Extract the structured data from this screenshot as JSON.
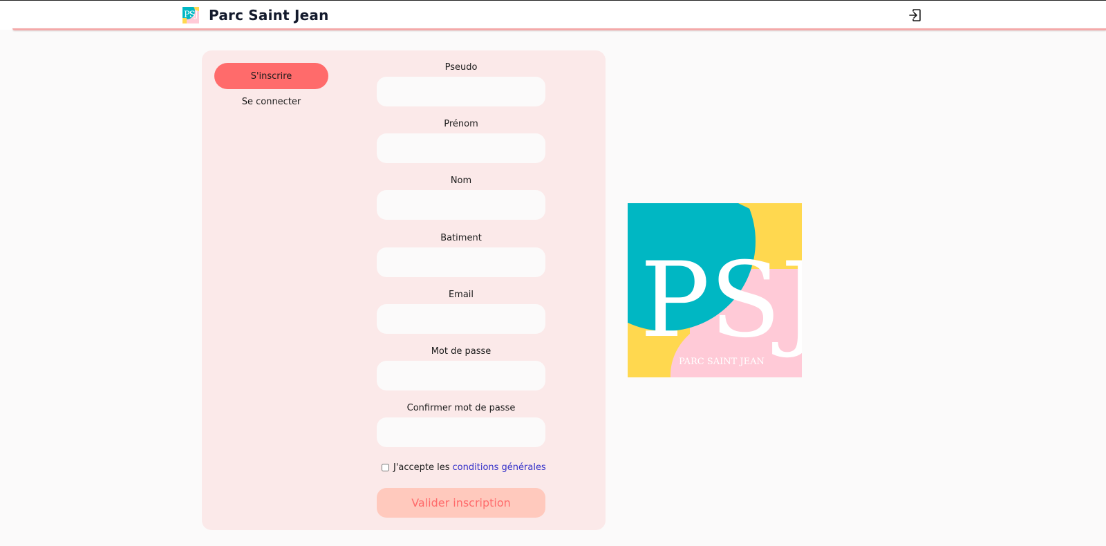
{
  "header": {
    "brand_logo_text": "PSJ",
    "title": "Parc Saint Jean",
    "logout_icon": "logout-icon"
  },
  "tabs": {
    "signup": "S'inscrire",
    "login": "Se connecter"
  },
  "form": {
    "fields": [
      {
        "label": "Pseudo",
        "value": "",
        "placeholder": ""
      },
      {
        "label": "Prénom",
        "value": "",
        "placeholder": ""
      },
      {
        "label": "Nom",
        "value": "",
        "placeholder": ""
      },
      {
        "label": "Batiment",
        "value": "",
        "placeholder": ""
      },
      {
        "label": "Email",
        "value": "",
        "placeholder": ""
      },
      {
        "label": "Mot de passe",
        "value": "",
        "placeholder": ""
      },
      {
        "label": "Confirmer mot de passe",
        "value": "",
        "placeholder": ""
      }
    ],
    "terms_prefix": "J'accepte les",
    "terms_link": "conditions générales",
    "terms_checked": false,
    "submit": "Valider inscription"
  },
  "logo": {
    "letters": "PSJ",
    "caption": "PARC SAINT JEAN"
  },
  "colors": {
    "accent": "#ff6b6b",
    "card_bg": "#fbe9e9",
    "teal": "#00b7c3",
    "yellow": "#ffd84f",
    "pink": "#ffcad7",
    "link": "#3330c9"
  }
}
